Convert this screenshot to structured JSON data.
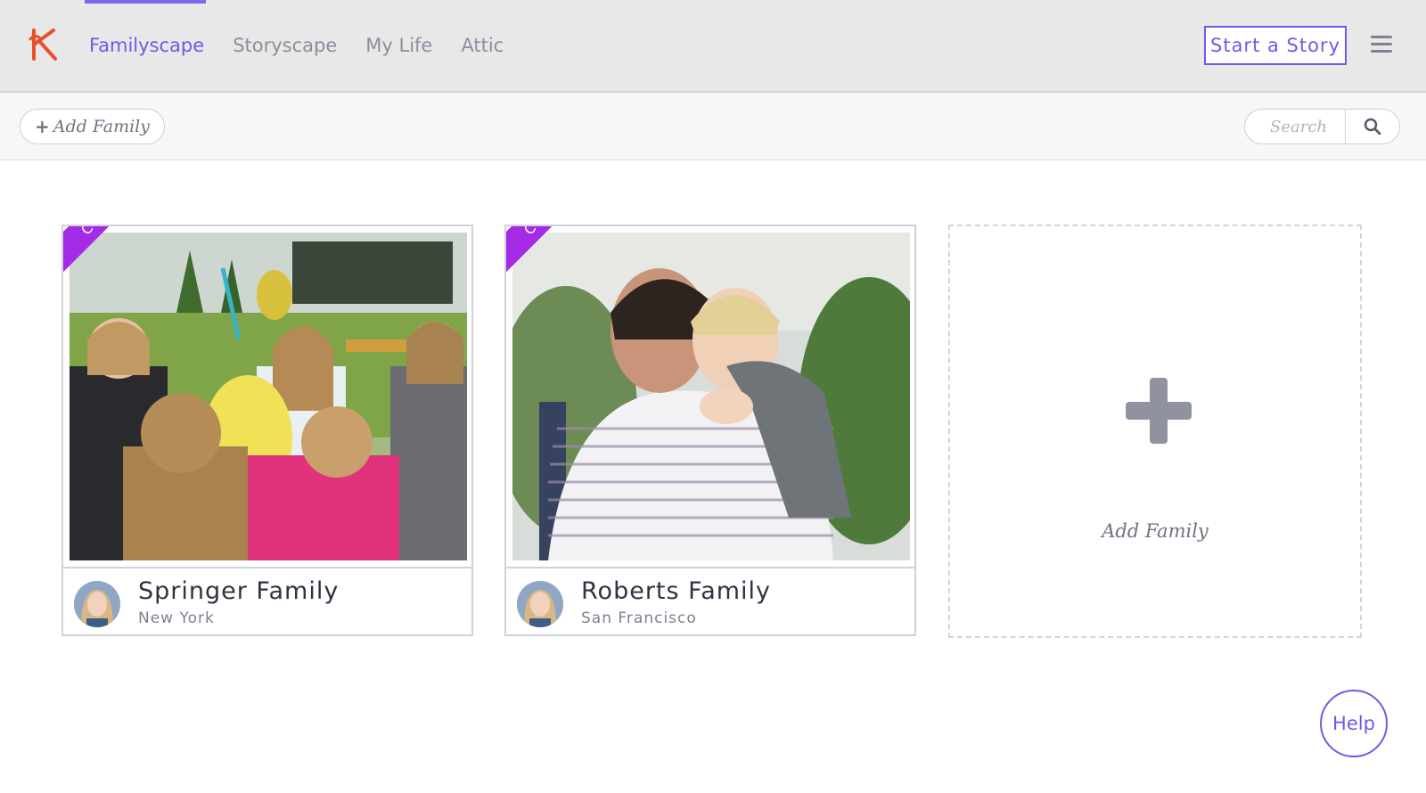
{
  "nav": {
    "logo_letter": "K",
    "items": [
      {
        "label": "Familyscape",
        "active": true
      },
      {
        "label": "Storyscape",
        "active": false
      },
      {
        "label": "My Life",
        "active": false
      },
      {
        "label": "Attic",
        "active": false
      }
    ],
    "start_story_label": "Start a Story",
    "menu_icon": "hamburger-menu-icon"
  },
  "toolbar": {
    "add_family_label": "Add Family",
    "search_placeholder": "Search",
    "search_icon": "search-icon"
  },
  "families": [
    {
      "badge": "CONNECTOR",
      "name": "Springer Family",
      "location": "New York"
    },
    {
      "badge": "CONNECTOR",
      "name": "Roberts Family",
      "location": "San Francisco"
    }
  ],
  "add_card": {
    "label": "Add Family",
    "icon": "plus-icon"
  },
  "help_label": "Help",
  "colors": {
    "accent": "#6b5ce7",
    "ribbon": "#a42be5",
    "logo": "#e8502a"
  }
}
